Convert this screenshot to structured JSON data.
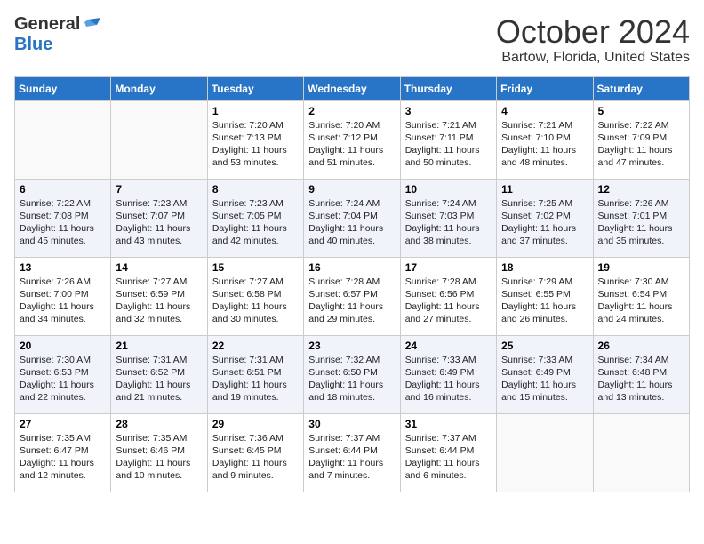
{
  "header": {
    "logo_general": "General",
    "logo_blue": "Blue",
    "month_title": "October 2024",
    "location": "Bartow, Florida, United States"
  },
  "days_of_week": [
    "Sunday",
    "Monday",
    "Tuesday",
    "Wednesday",
    "Thursday",
    "Friday",
    "Saturday"
  ],
  "weeks": [
    [
      {
        "day": "",
        "sunrise": "",
        "sunset": "",
        "daylight": ""
      },
      {
        "day": "",
        "sunrise": "",
        "sunset": "",
        "daylight": ""
      },
      {
        "day": "1",
        "sunrise": "Sunrise: 7:20 AM",
        "sunset": "Sunset: 7:13 PM",
        "daylight": "Daylight: 11 hours and 53 minutes."
      },
      {
        "day": "2",
        "sunrise": "Sunrise: 7:20 AM",
        "sunset": "Sunset: 7:12 PM",
        "daylight": "Daylight: 11 hours and 51 minutes."
      },
      {
        "day": "3",
        "sunrise": "Sunrise: 7:21 AM",
        "sunset": "Sunset: 7:11 PM",
        "daylight": "Daylight: 11 hours and 50 minutes."
      },
      {
        "day": "4",
        "sunrise": "Sunrise: 7:21 AM",
        "sunset": "Sunset: 7:10 PM",
        "daylight": "Daylight: 11 hours and 48 minutes."
      },
      {
        "day": "5",
        "sunrise": "Sunrise: 7:22 AM",
        "sunset": "Sunset: 7:09 PM",
        "daylight": "Daylight: 11 hours and 47 minutes."
      }
    ],
    [
      {
        "day": "6",
        "sunrise": "Sunrise: 7:22 AM",
        "sunset": "Sunset: 7:08 PM",
        "daylight": "Daylight: 11 hours and 45 minutes."
      },
      {
        "day": "7",
        "sunrise": "Sunrise: 7:23 AM",
        "sunset": "Sunset: 7:07 PM",
        "daylight": "Daylight: 11 hours and 43 minutes."
      },
      {
        "day": "8",
        "sunrise": "Sunrise: 7:23 AM",
        "sunset": "Sunset: 7:05 PM",
        "daylight": "Daylight: 11 hours and 42 minutes."
      },
      {
        "day": "9",
        "sunrise": "Sunrise: 7:24 AM",
        "sunset": "Sunset: 7:04 PM",
        "daylight": "Daylight: 11 hours and 40 minutes."
      },
      {
        "day": "10",
        "sunrise": "Sunrise: 7:24 AM",
        "sunset": "Sunset: 7:03 PM",
        "daylight": "Daylight: 11 hours and 38 minutes."
      },
      {
        "day": "11",
        "sunrise": "Sunrise: 7:25 AM",
        "sunset": "Sunset: 7:02 PM",
        "daylight": "Daylight: 11 hours and 37 minutes."
      },
      {
        "day": "12",
        "sunrise": "Sunrise: 7:26 AM",
        "sunset": "Sunset: 7:01 PM",
        "daylight": "Daylight: 11 hours and 35 minutes."
      }
    ],
    [
      {
        "day": "13",
        "sunrise": "Sunrise: 7:26 AM",
        "sunset": "Sunset: 7:00 PM",
        "daylight": "Daylight: 11 hours and 34 minutes."
      },
      {
        "day": "14",
        "sunrise": "Sunrise: 7:27 AM",
        "sunset": "Sunset: 6:59 PM",
        "daylight": "Daylight: 11 hours and 32 minutes."
      },
      {
        "day": "15",
        "sunrise": "Sunrise: 7:27 AM",
        "sunset": "Sunset: 6:58 PM",
        "daylight": "Daylight: 11 hours and 30 minutes."
      },
      {
        "day": "16",
        "sunrise": "Sunrise: 7:28 AM",
        "sunset": "Sunset: 6:57 PM",
        "daylight": "Daylight: 11 hours and 29 minutes."
      },
      {
        "day": "17",
        "sunrise": "Sunrise: 7:28 AM",
        "sunset": "Sunset: 6:56 PM",
        "daylight": "Daylight: 11 hours and 27 minutes."
      },
      {
        "day": "18",
        "sunrise": "Sunrise: 7:29 AM",
        "sunset": "Sunset: 6:55 PM",
        "daylight": "Daylight: 11 hours and 26 minutes."
      },
      {
        "day": "19",
        "sunrise": "Sunrise: 7:30 AM",
        "sunset": "Sunset: 6:54 PM",
        "daylight": "Daylight: 11 hours and 24 minutes."
      }
    ],
    [
      {
        "day": "20",
        "sunrise": "Sunrise: 7:30 AM",
        "sunset": "Sunset: 6:53 PM",
        "daylight": "Daylight: 11 hours and 22 minutes."
      },
      {
        "day": "21",
        "sunrise": "Sunrise: 7:31 AM",
        "sunset": "Sunset: 6:52 PM",
        "daylight": "Daylight: 11 hours and 21 minutes."
      },
      {
        "day": "22",
        "sunrise": "Sunrise: 7:31 AM",
        "sunset": "Sunset: 6:51 PM",
        "daylight": "Daylight: 11 hours and 19 minutes."
      },
      {
        "day": "23",
        "sunrise": "Sunrise: 7:32 AM",
        "sunset": "Sunset: 6:50 PM",
        "daylight": "Daylight: 11 hours and 18 minutes."
      },
      {
        "day": "24",
        "sunrise": "Sunrise: 7:33 AM",
        "sunset": "Sunset: 6:49 PM",
        "daylight": "Daylight: 11 hours and 16 minutes."
      },
      {
        "day": "25",
        "sunrise": "Sunrise: 7:33 AM",
        "sunset": "Sunset: 6:49 PM",
        "daylight": "Daylight: 11 hours and 15 minutes."
      },
      {
        "day": "26",
        "sunrise": "Sunrise: 7:34 AM",
        "sunset": "Sunset: 6:48 PM",
        "daylight": "Daylight: 11 hours and 13 minutes."
      }
    ],
    [
      {
        "day": "27",
        "sunrise": "Sunrise: 7:35 AM",
        "sunset": "Sunset: 6:47 PM",
        "daylight": "Daylight: 11 hours and 12 minutes."
      },
      {
        "day": "28",
        "sunrise": "Sunrise: 7:35 AM",
        "sunset": "Sunset: 6:46 PM",
        "daylight": "Daylight: 11 hours and 10 minutes."
      },
      {
        "day": "29",
        "sunrise": "Sunrise: 7:36 AM",
        "sunset": "Sunset: 6:45 PM",
        "daylight": "Daylight: 11 hours and 9 minutes."
      },
      {
        "day": "30",
        "sunrise": "Sunrise: 7:37 AM",
        "sunset": "Sunset: 6:44 PM",
        "daylight": "Daylight: 11 hours and 7 minutes."
      },
      {
        "day": "31",
        "sunrise": "Sunrise: 7:37 AM",
        "sunset": "Sunset: 6:44 PM",
        "daylight": "Daylight: 11 hours and 6 minutes."
      },
      {
        "day": "",
        "sunrise": "",
        "sunset": "",
        "daylight": ""
      },
      {
        "day": "",
        "sunrise": "",
        "sunset": "",
        "daylight": ""
      }
    ]
  ]
}
